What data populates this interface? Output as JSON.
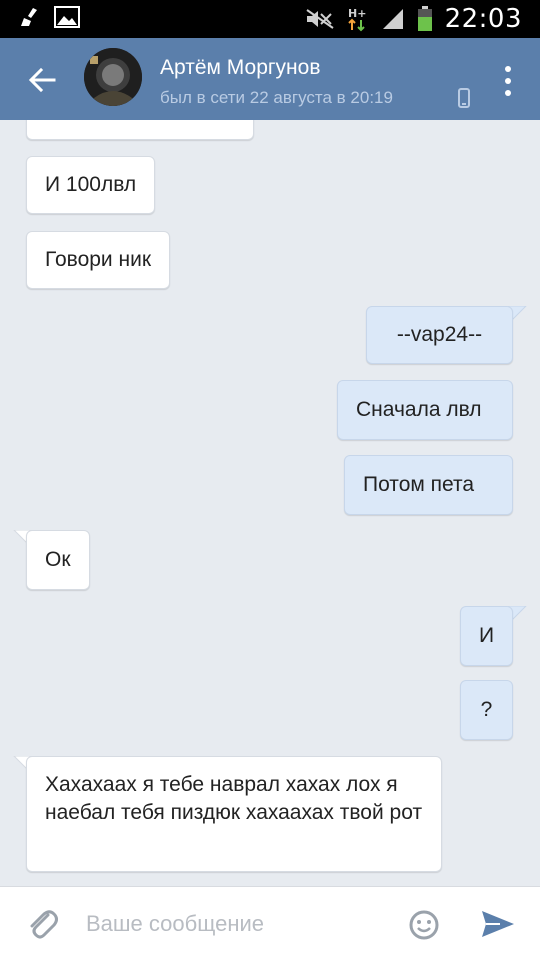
{
  "statusbar": {
    "time": "22:03",
    "icons": [
      "broom-icon",
      "image-icon",
      "mute-icon",
      "hplus-network-icon",
      "signal-icon",
      "battery-icon"
    ]
  },
  "header": {
    "contact_name": "Артём Моргунов",
    "status": "был в сети 22 августа в 20:19",
    "icons": [
      "back-arrow-icon",
      "mobile-phone-icon",
      "more-vertical-icon"
    ],
    "color": "#5b7fab"
  },
  "messages": [
    {
      "side": "in",
      "text": ""
    },
    {
      "side": "in",
      "text": "И 100лвл"
    },
    {
      "side": "in",
      "text": "Говори ник"
    },
    {
      "side": "out",
      "text": "--vap24--"
    },
    {
      "side": "out",
      "text": "Сначала лвл"
    },
    {
      "side": "out",
      "text": "Потом пета"
    },
    {
      "side": "in",
      "text": "Ок"
    },
    {
      "side": "out",
      "text": "И"
    },
    {
      "side": "out",
      "text": "?"
    },
    {
      "side": "in",
      "text": "Хахахаах я тебе наврал хахах лох я наебал тебя пиздюк хахаахах твой рот"
    }
  ],
  "composer": {
    "placeholder": "Ваше сообщение",
    "icons": [
      "paperclip-icon",
      "emoji-icon",
      "send-icon"
    ],
    "send_color": "#5b7fab"
  },
  "colors": {
    "background": "#e7ebf0",
    "incoming_bubble": "#ffffff",
    "outgoing_bubble": "#dbe8f8"
  }
}
